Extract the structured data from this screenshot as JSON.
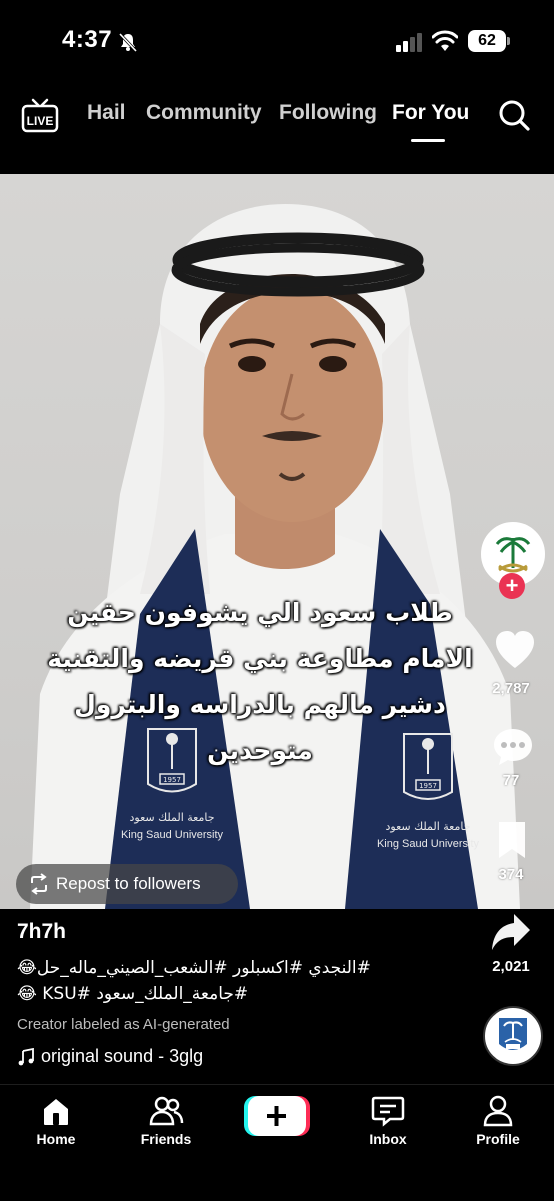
{
  "status_bar": {
    "time": "4:37",
    "battery": "62"
  },
  "top_nav": {
    "live_label": "LIVE",
    "tabs": [
      "Hail",
      "Community",
      "Following",
      "For You"
    ],
    "active_tab": "For You"
  },
  "video": {
    "overlay_text_lines": [
      "طلاب سعود الي يشوفون حقين",
      "الامام مطاوعة بني قريضه والتقنية",
      "دشير مالهم بالدراسه والبترول",
      "متوحدين"
    ],
    "scarf_text_ar": "جامعة الملك سعود",
    "scarf_text_en": "King Saud University",
    "scarf_year": "1957"
  },
  "right_rail": {
    "likes": "2,787",
    "comments": "77",
    "bookmarks": "374",
    "shares": "2,021"
  },
  "repost": {
    "label": "Repost to followers"
  },
  "caption": {
    "username": "7h7h",
    "hashtags_line1": "#النجدي #اكسبلور #الشعب_الصيني_ماله_حل😂",
    "hashtags_line2": "#جامعة_الملك_سعود #KSU 😂",
    "ai_label": "Creator labeled as AI-generated",
    "sound": "original sound - 3glg"
  },
  "bottom_nav": {
    "home": "Home",
    "friends": "Friends",
    "inbox": "Inbox",
    "profile": "Profile"
  },
  "colors": {
    "accent_red": "#ea3353",
    "scarf_navy": "#1d2d57",
    "university_blue": "#2a62a8"
  },
  "icons": [
    "bell-slash-icon",
    "signal-icon",
    "wifi-icon",
    "live-icon",
    "search-icon",
    "heart-icon",
    "comment-icon",
    "bookmark-icon",
    "share-icon",
    "repost-icon",
    "music-note-icon",
    "home-icon",
    "friends-icon",
    "plus-icon",
    "inbox-icon",
    "profile-icon"
  ]
}
